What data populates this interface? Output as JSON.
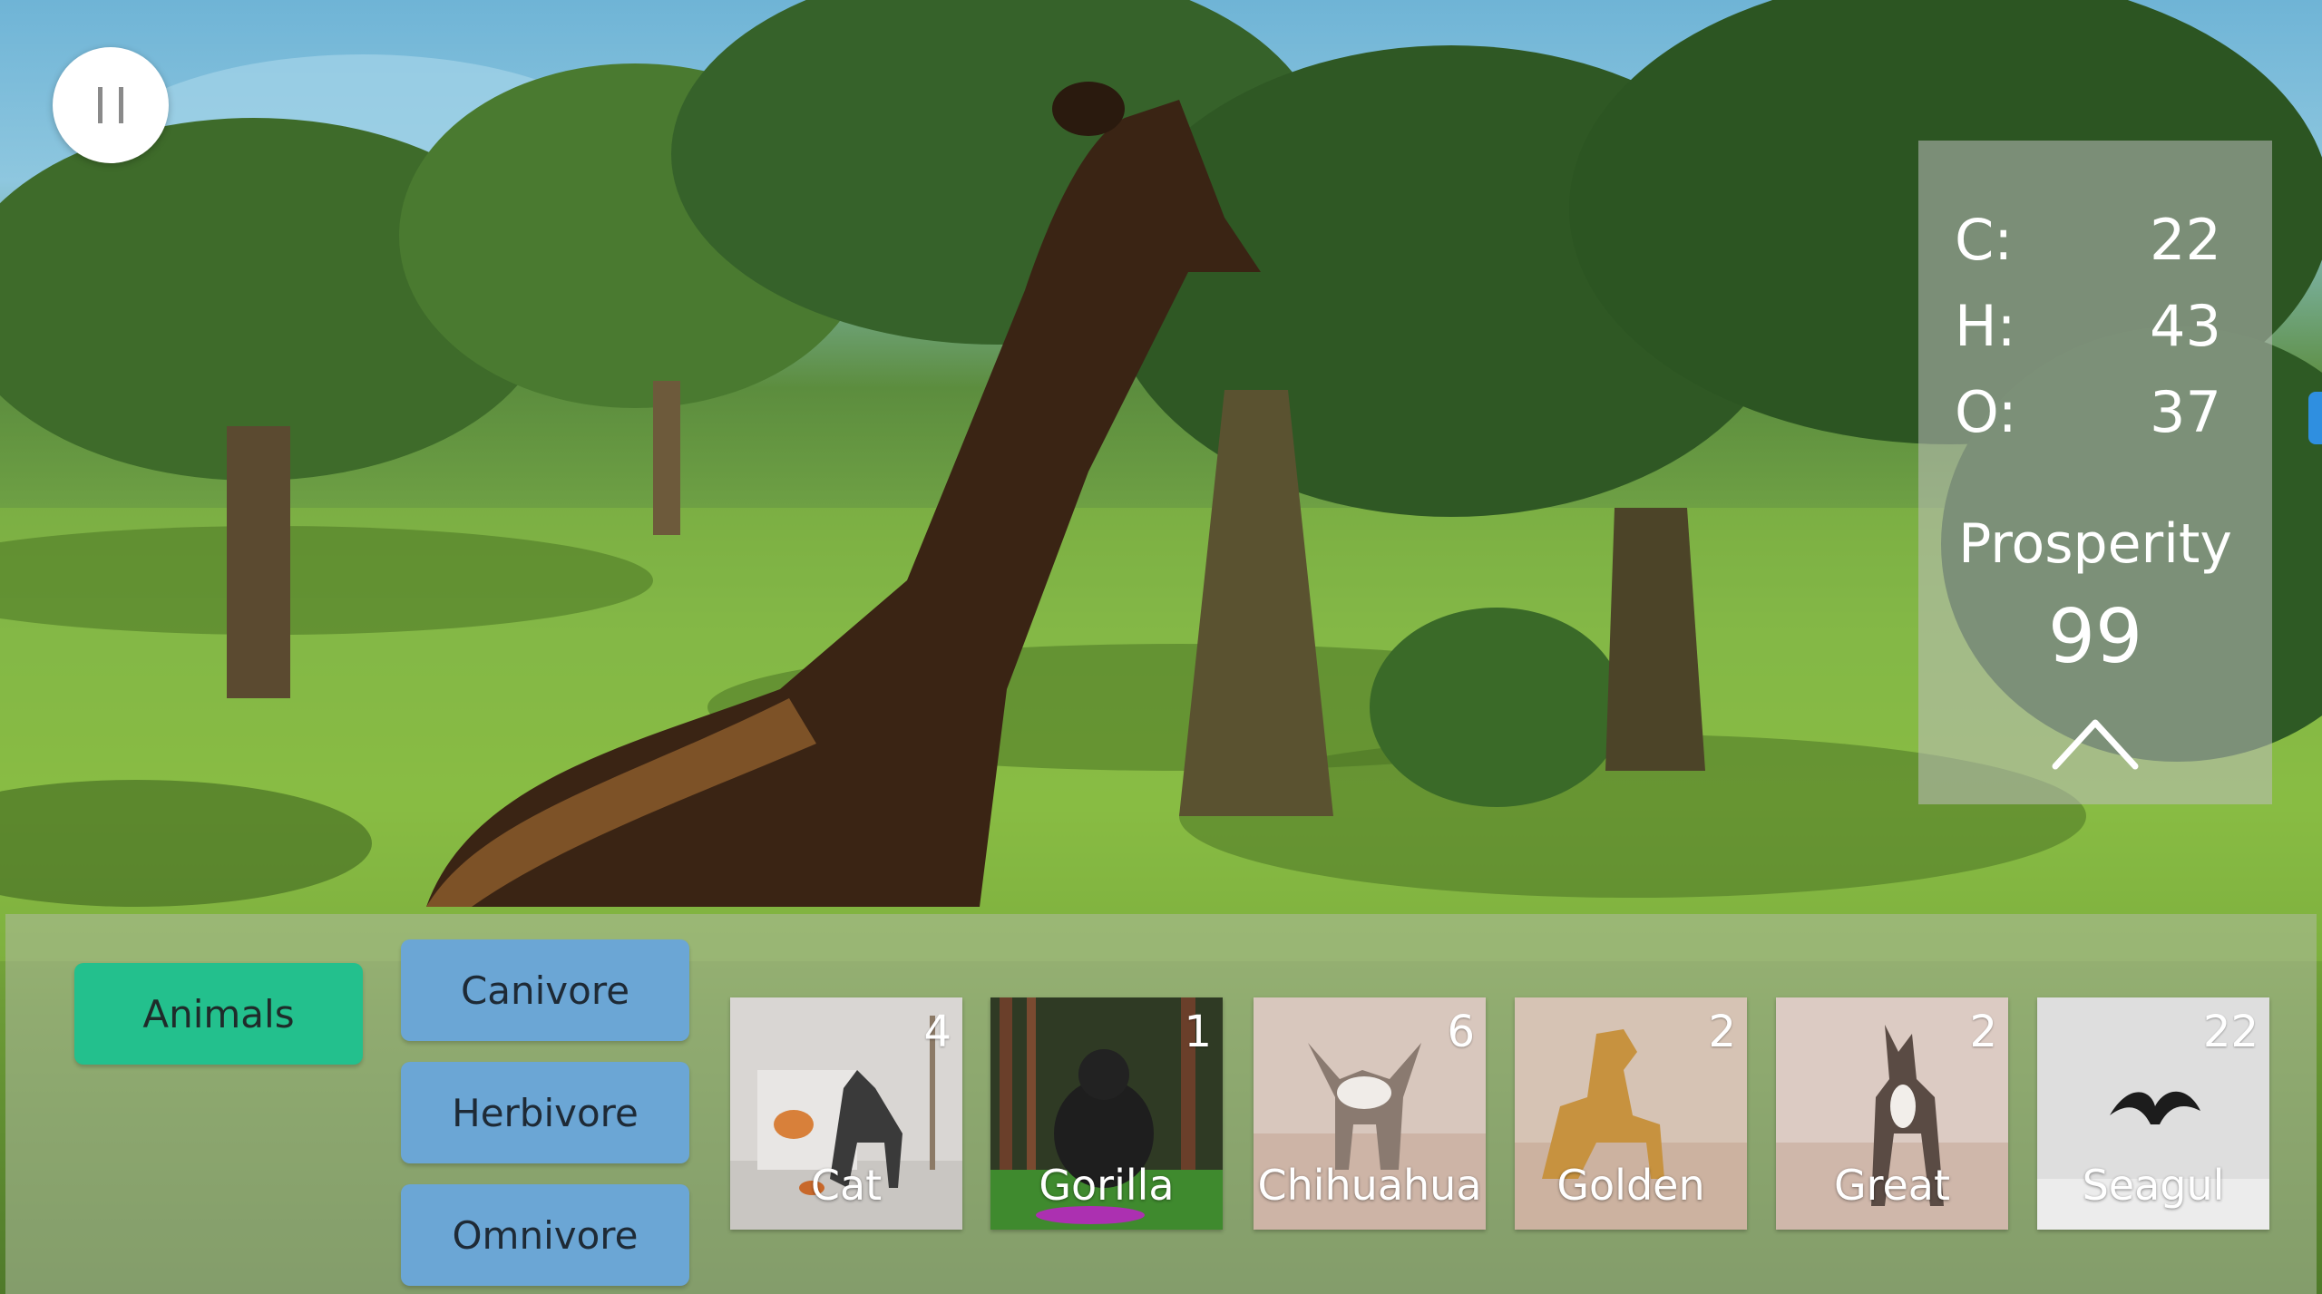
{
  "pause_button": {
    "icon": "pause-icon"
  },
  "stats": {
    "rows": [
      {
        "label": "C:",
        "value": "22"
      },
      {
        "label": "H:",
        "value": "43"
      },
      {
        "label": "O:",
        "value": "37"
      }
    ],
    "prosperity_label": "Prosperity",
    "prosperity_value": "99",
    "collapse_icon": "chevron-up-icon"
  },
  "categories": {
    "main": "Animals",
    "carnivore": "Canivore",
    "herbivore": "Herbivore",
    "omnivore": "Omnivore"
  },
  "animals": [
    {
      "name": "Cat",
      "count": "4"
    },
    {
      "name": "Gorilla",
      "count": "1"
    },
    {
      "name": "Chihuahua",
      "count": "6"
    },
    {
      "name": "Golden",
      "count": "2"
    },
    {
      "name": "Great",
      "count": "2"
    },
    {
      "name": "Seagul",
      "count": "22"
    }
  ],
  "colors": {
    "animals_button": "#23c08d",
    "diet_button": "#6ba6d5",
    "stats_panel": "#bebebe",
    "edge_tab": "#2f8fe0"
  }
}
